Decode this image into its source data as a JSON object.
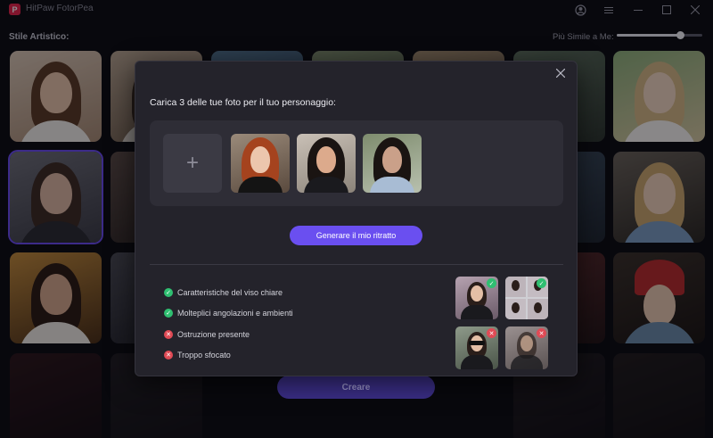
{
  "app": {
    "title": "HitPaw FotorPea",
    "logo_letter": "P"
  },
  "window_controls": [
    "profile-icon",
    "menu-icon",
    "minimize-icon",
    "maximize-icon",
    "close-icon"
  ],
  "style_section": {
    "label": "Stile Artistico:",
    "similarity_label": "Più Simile a Me:",
    "similarity_value": 0.74
  },
  "create_button": "Creare",
  "modal": {
    "prompt": "Carica 3 delle tue foto per il tuo personaggio:",
    "add_symbol": "+",
    "generate_button": "Generare il mio ritratto",
    "tips": [
      {
        "status": "ok",
        "text": "Caratteristiche del viso chiare"
      },
      {
        "status": "ok",
        "text": "Molteplici angolazioni e ambienti"
      },
      {
        "status": "bad",
        "text": "Ostruzione presente"
      },
      {
        "status": "bad",
        "text": "Troppo sfocato"
      }
    ]
  },
  "colors": {
    "accent": "#6a4ff0",
    "ok": "#2fbf71",
    "bad": "#e04a55",
    "modal_bg": "#24232b"
  }
}
